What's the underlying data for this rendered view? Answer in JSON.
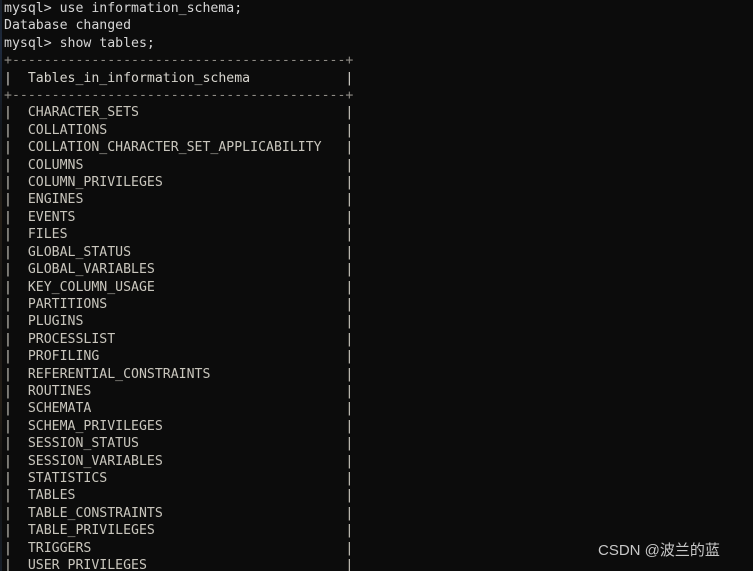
{
  "terminal": {
    "background_color": "#0c0c0c",
    "text_color": "#cfcfcf",
    "prompt_lines": [
      "mysql> use information_schema;",
      "Database changed",
      "mysql> show tables;"
    ],
    "table": {
      "top_rule": "+------------------------------------------+",
      "header_row": "| Tables_in_information_schema             |",
      "header_label": "Tables_in_information_schema",
      "header_rule": "+------------------------------------------+",
      "rows": [
        "CHARACTER_SETS",
        "COLLATIONS",
        "COLLATION_CHARACTER_SET_APPLICABILITY",
        "COLUMNS",
        "COLUMN_PRIVILEGES",
        "ENGINES",
        "EVENTS",
        "FILES",
        "GLOBAL_STATUS",
        "GLOBAL_VARIABLES",
        "KEY_COLUMN_USAGE",
        "PARTITIONS",
        "PLUGINS",
        "PROCESSLIST",
        "PROFILING",
        "REFERENTIAL_CONSTRAINTS",
        "ROUTINES",
        "SCHEMATA",
        "SCHEMA_PRIVILEGES",
        "SESSION_STATUS",
        "SESSION_VARIABLES",
        "STATISTICS",
        "TABLES",
        "TABLE_CONSTRAINTS",
        "TABLE_PRIVILEGES",
        "TRIGGERS",
        "USER_PRIVILEGES"
      ]
    }
  },
  "watermark": {
    "text": "CSDN @波兰的蓝"
  }
}
